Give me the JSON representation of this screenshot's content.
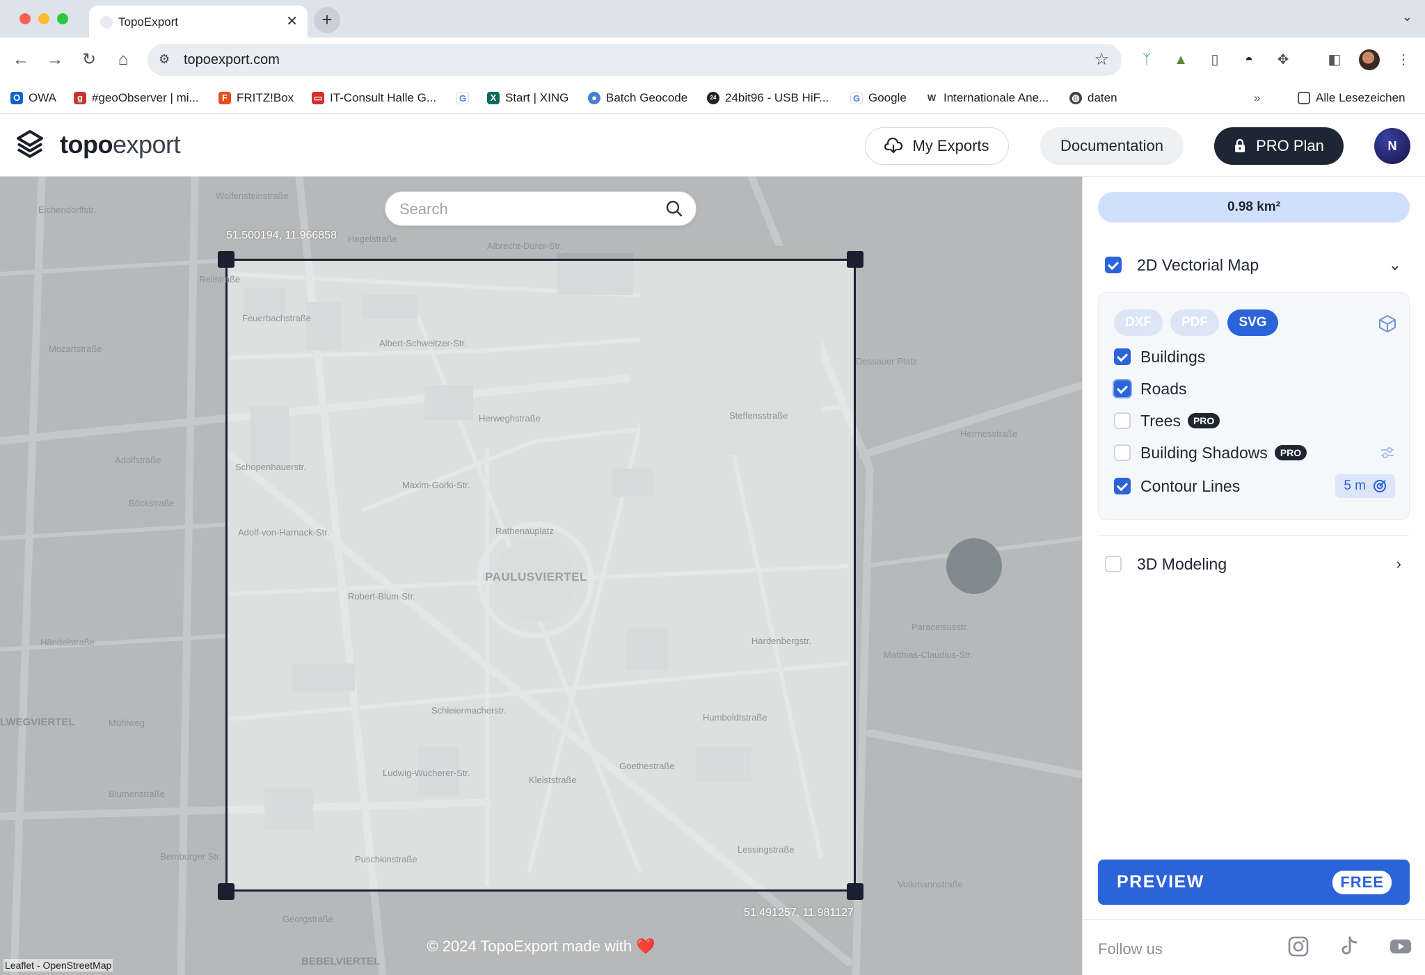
{
  "browser": {
    "tab_title": "TopoExport",
    "tab_close": "✕",
    "new_tab": "+",
    "url": "topoexport.com",
    "bookmarks": [
      {
        "label": "OWA",
        "icon": "outlook-icon",
        "color": "#0a64c9"
      },
      {
        "label": "#geoObserver | mi...",
        "icon": "geoobserver-icon",
        "color": "#c0392b"
      },
      {
        "label": "FRITZ!Box",
        "icon": "fritzbox-icon",
        "color": "#e84d1c"
      },
      {
        "label": "IT-Consult Halle G...",
        "icon": "itconsult-icon",
        "color": "#d32f2f"
      },
      {
        "label": "",
        "icon": "google-icon",
        "color": "#4285f4"
      },
      {
        "label": "Start | XING",
        "icon": "xing-icon",
        "color": "#0a6b5e"
      },
      {
        "label": "Batch Geocode",
        "icon": "globe-icon",
        "color": "#4a7fd1"
      },
      {
        "label": "24bit96 - USB HiF...",
        "icon": "24bit96-icon",
        "color": "#222222"
      },
      {
        "label": "Google",
        "icon": "google-icon",
        "color": "#4285f4"
      },
      {
        "label": "Internationale Ane...",
        "icon": "wikipedia-icon",
        "color": "#333333"
      },
      {
        "label": "daten",
        "icon": "globe-icon",
        "color": "#444444"
      }
    ],
    "all_bookmarks": "Alle Lesezeichen"
  },
  "header": {
    "logo_bold": "topo",
    "logo_light": "export",
    "my_exports": "My Exports",
    "documentation": "Documentation",
    "pro_plan": "PRO Plan",
    "avatar_initial": "N"
  },
  "map": {
    "search_placeholder": "Search",
    "coord_top_left": "51.500194, 11.966858",
    "coord_bottom_right": "51.491257, 11.981127",
    "district": "PAULUSVIERTEL",
    "footer": "© 2024 TopoExport made with ❤️",
    "attribution": "Leaflet - OpenStreetMap",
    "street_labels": [
      "Albrecht-Dürer-Str.",
      "Hegelstraße",
      "Albert-Schweitzer-Str.",
      "Feuerbachstraße",
      "Herweghstraße",
      "Steffensstraße",
      "Schopenhauerstr.",
      "Maxim-Gorki-Str.",
      "Rathenauplatz",
      "Adolf-von-Harnack-Str.",
      "Robert-Blum-Str.",
      "Mozartstraße",
      "Adolfstraße",
      "Böckstraße",
      "Händelstraße",
      "Mühlweg",
      "Blumenstraße",
      "Puschkinstraße",
      "Georgstraße",
      "Paracelsusstr.",
      "Dessauer Platz",
      "Hermesstraße",
      "Hardenbergstr.",
      "Matthias-Claudius-Str.",
      "Volkmannstraße",
      "Lessingstraße",
      "Goethestraße",
      "Humboldtstraße",
      "Reilstraße",
      "Bernburger Str.",
      "Ludwig-Wucherer-Str.",
      "Schleiermacherstr.",
      "Wolfensteinstraße",
      "Eichendorffstr.",
      "Kleiststraße",
      "LWEGVIERTEL",
      "BEBELVIERTEL"
    ]
  },
  "sidebar": {
    "area": "0.98 km²",
    "section_2d": {
      "label": "2D Vectorial Map",
      "checked": true
    },
    "formats": [
      {
        "label": "DXF",
        "active": false
      },
      {
        "label": "PDF",
        "active": false
      },
      {
        "label": "SVG",
        "active": true
      }
    ],
    "layers": [
      {
        "label": "Buildings",
        "checked": true,
        "pro": false
      },
      {
        "label": "Roads",
        "checked": true,
        "pro": false
      },
      {
        "label": "Trees",
        "checked": false,
        "pro": true
      },
      {
        "label": "Building Shadows",
        "checked": false,
        "pro": true
      },
      {
        "label": "Contour Lines",
        "checked": true,
        "pro": false
      }
    ],
    "pro_badge": "PRO",
    "contour_interval": "5 m",
    "section_3d": {
      "label": "3D Modeling",
      "checked": false
    },
    "preview_label": "PREVIEW",
    "preview_badge": "FREE",
    "follow_us": "Follow us"
  },
  "colors": {
    "accent": "#2b63d9",
    "dark": "#1e2533",
    "area_pill": "#cfe0fb"
  }
}
